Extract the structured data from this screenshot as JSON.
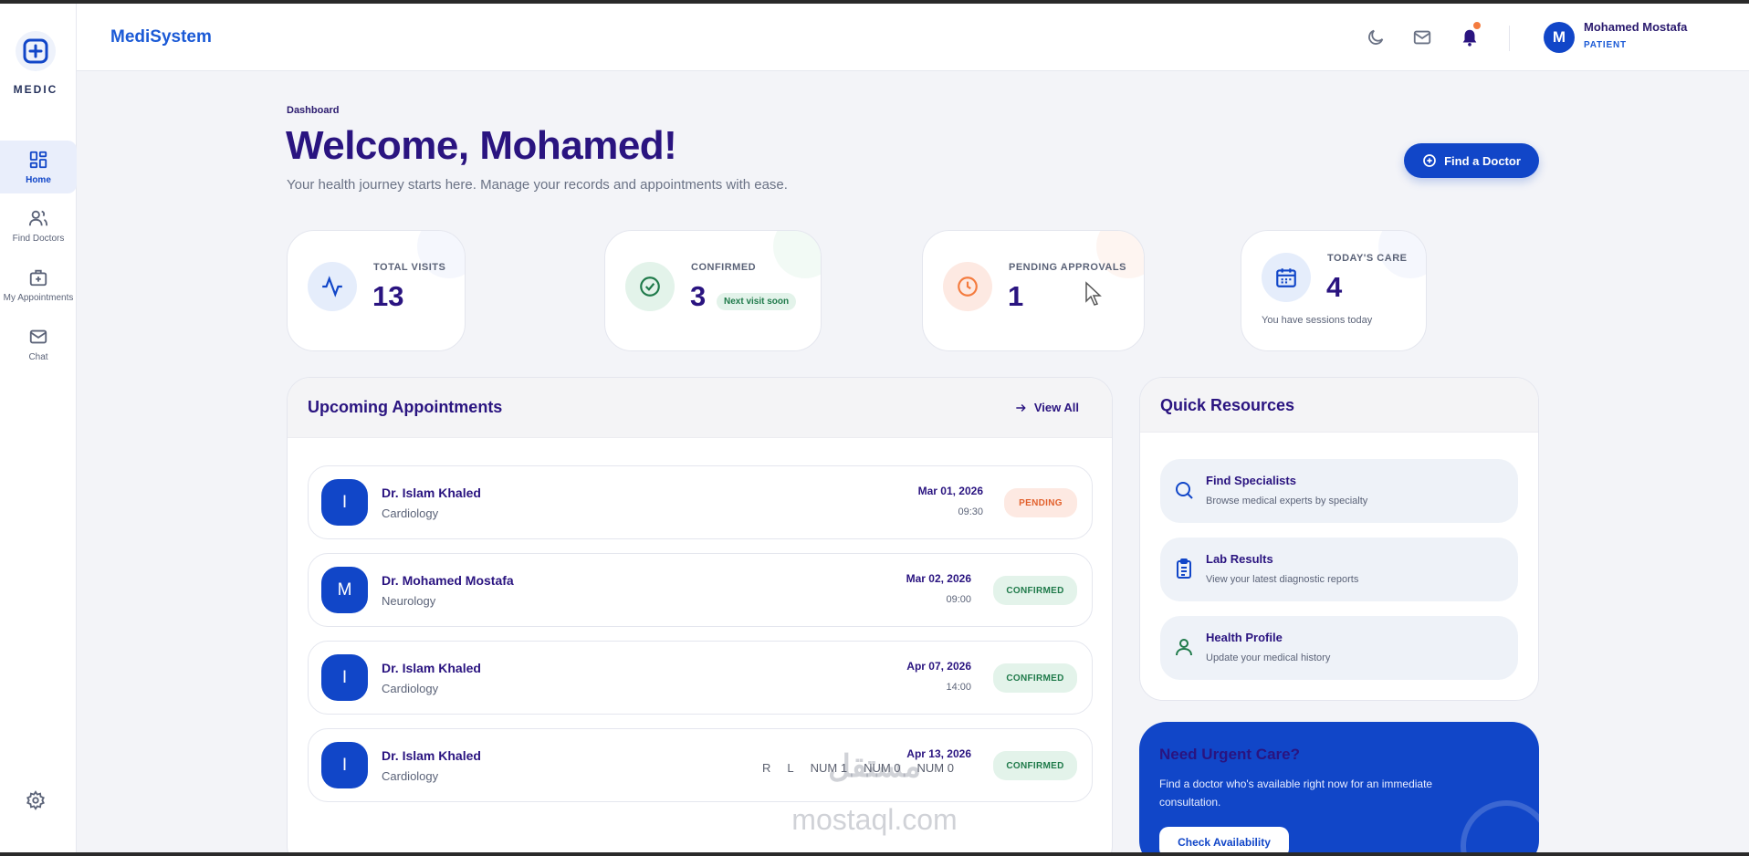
{
  "app": {
    "logo_text": "MEDIC",
    "brand": "MediSystem"
  },
  "sidebar": {
    "items": [
      {
        "label": "Home",
        "icon": "grid-icon",
        "active": true
      },
      {
        "label": "Find Doctors",
        "icon": "users-icon",
        "active": false
      },
      {
        "label": "My Appointments",
        "icon": "medical-bag-icon",
        "active": false
      },
      {
        "label": "Chat",
        "icon": "mail-icon",
        "active": false
      }
    ],
    "settings_icon": "gear-icon"
  },
  "header": {
    "icons": [
      "moon-icon",
      "mail-icon",
      "bell-icon"
    ],
    "user": {
      "initial": "M",
      "name": "Mohamed Mostafa",
      "role": "PATIENT"
    }
  },
  "main": {
    "breadcrumb": "Dashboard",
    "title": "Welcome, Mohamed!",
    "subtitle": "Your health journey starts here. Manage your records and appointments with ease.",
    "find_doctor_label": "Find a Doctor"
  },
  "stats": [
    {
      "label": "TOTAL VISITS",
      "value": "13",
      "icon": "activity-icon",
      "color": "#1146c8"
    },
    {
      "label": "CONFIRMED",
      "value": "3",
      "pill": "Next visit soon",
      "icon": "check-circle-icon",
      "color": "#1f7a4a"
    },
    {
      "label": "PENDING APPROVALS",
      "value": "1",
      "icon": "clock-icon",
      "color": "#f47b3e"
    },
    {
      "label": "TODAY'S CARE",
      "value": "4",
      "note": "You have sessions today",
      "icon": "calendar-icon",
      "color": "#1146c8"
    }
  ],
  "appointments": {
    "title": "Upcoming Appointments",
    "view_all": "View All",
    "rows": [
      {
        "initial": "I",
        "doctor": "Dr. Islam Khaled",
        "specialty": "Cardiology",
        "date": "Mar 01, 2026",
        "time": "09:30",
        "status": "PENDING"
      },
      {
        "initial": "M",
        "doctor": "Dr. Mohamed Mostafa",
        "specialty": "Neurology",
        "date": "Mar 02, 2026",
        "time": "09:00",
        "status": "CONFIRMED"
      },
      {
        "initial": "I",
        "doctor": "Dr. Islam Khaled",
        "specialty": "Cardiology",
        "date": "Apr 07, 2026",
        "time": "14:00",
        "status": "CONFIRMED"
      },
      {
        "initial": "I",
        "doctor": "Dr. Islam Khaled",
        "specialty": "Cardiology",
        "date": "Apr 13, 2026",
        "time": "",
        "status": "CONFIRMED"
      }
    ]
  },
  "resources": {
    "title": "Quick Resources",
    "items": [
      {
        "title": "Find Specialists",
        "desc": "Browse medical experts by specialty",
        "icon": "search-icon"
      },
      {
        "title": "Lab Results",
        "desc": "View your latest diagnostic reports",
        "icon": "clipboard-icon"
      },
      {
        "title": "Health Profile",
        "desc": "Update your medical history",
        "icon": "user-icon"
      }
    ]
  },
  "urgent": {
    "title": "Need Urgent Care?",
    "desc": "Find a doctor who's available right now for an immediate consultation.",
    "button": "Check Availability"
  },
  "overlay": {
    "keys": [
      "R",
      "L",
      "NUM 1",
      "NUM 0",
      "NUM 0"
    ],
    "watermark_ar": "مستقل",
    "watermark_en": "mostaql.com"
  }
}
